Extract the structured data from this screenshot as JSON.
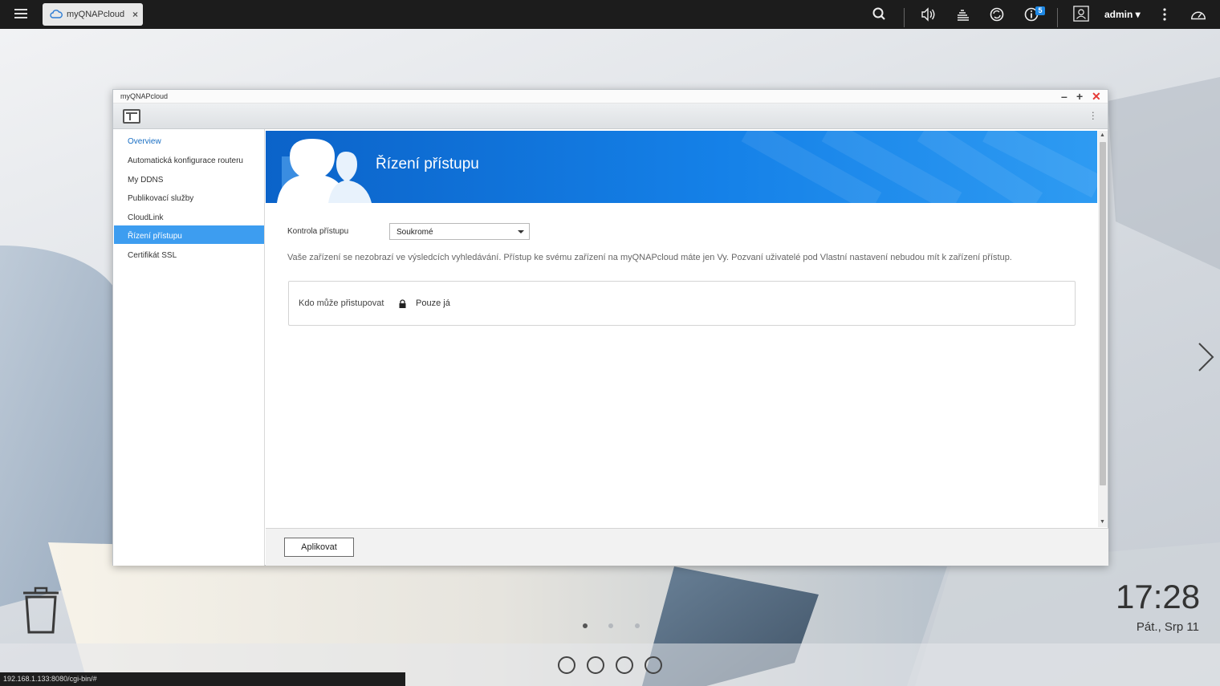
{
  "topbar": {
    "tab_label": "myQNAPcloud",
    "tab_close": "×",
    "notification_count": "5",
    "user_name": "admin ▾"
  },
  "window": {
    "title": "myQNAPcloud",
    "minimize": "–",
    "maximize": "+",
    "close": "✕"
  },
  "sidebar": {
    "items": [
      {
        "label": "Overview"
      },
      {
        "label": "Automatická konfigurace routeru"
      },
      {
        "label": "My DDNS"
      },
      {
        "label": "Publikovací služby"
      },
      {
        "label": "CloudLink"
      },
      {
        "label": "Řízení přístupu"
      },
      {
        "label": "Certifikát SSL"
      }
    ]
  },
  "main": {
    "banner_title": "Řízení přístupu",
    "access_control_label": "Kontrola přístupu",
    "access_control_value": "Soukromé",
    "description": "Vaše zařízení se nezobrazí ve výsledcích vyhledávání. Přístup ke svému zařízení na myQNAPcloud máte jen Vy. Pozvaní uživatelé pod Vlastní nastavení nebudou mít k zařízení přístup.",
    "who_label": "Kdo může přistupovat",
    "who_value": "Pouze já",
    "apply_label": "Aplikovat"
  },
  "desktop": {
    "time": "17:28",
    "date": "Pát., Srp 11",
    "status_url": "192.168.1.133:8080/cgi-bin/#",
    "active_page_dot": 1,
    "page_dot_count": 3
  },
  "colors": {
    "accent": "#3d9df0",
    "banner": "#1581e8",
    "close_red": "#e53935"
  }
}
